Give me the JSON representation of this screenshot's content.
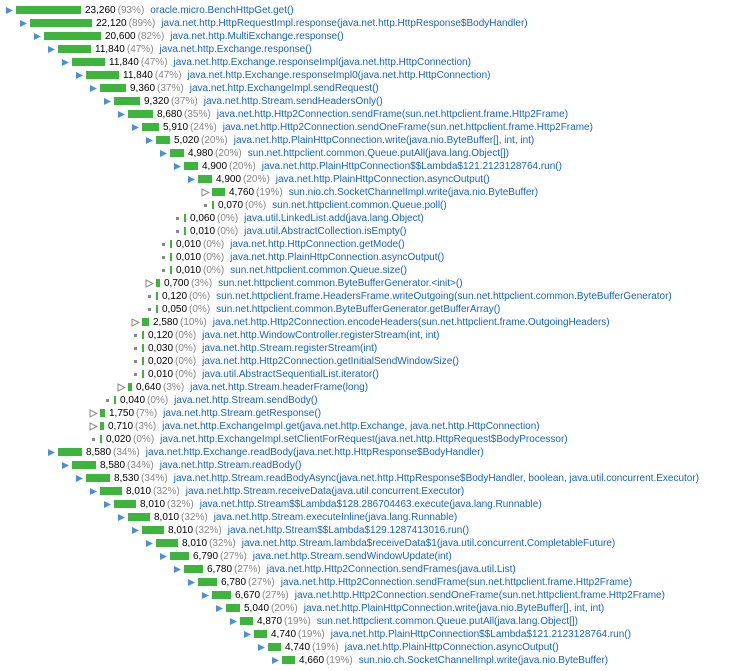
{
  "bar_max_width": 70,
  "rows": [
    {
      "d": 0,
      "t": "open",
      "time": "23,260",
      "pct": "93%",
      "w": 93,
      "m": "oracle.micro.BenchHttpGet.get()"
    },
    {
      "d": 1,
      "t": "open",
      "time": "22,120",
      "pct": "89%",
      "w": 89,
      "m": "java.net.http.HttpRequestImpl.response(java.net.http.HttpResponse$BodyHandler)"
    },
    {
      "d": 2,
      "t": "open",
      "time": "20,600",
      "pct": "82%",
      "w": 82,
      "m": "java.net.http.MultiExchange.response()"
    },
    {
      "d": 3,
      "t": "open",
      "time": "11,840",
      "pct": "47%",
      "w": 47,
      "m": "java.net.http.Exchange.response()"
    },
    {
      "d": 4,
      "t": "open",
      "time": "11,840",
      "pct": "47%",
      "w": 47,
      "m": "java.net.http.Exchange.responseImpl(java.net.http.HttpConnection)"
    },
    {
      "d": 5,
      "t": "open",
      "time": "11,840",
      "pct": "47%",
      "w": 47,
      "m": "java.net.http.Exchange.responseImpl0(java.net.http.HttpConnection)"
    },
    {
      "d": 6,
      "t": "open",
      "time": "9,360",
      "pct": "37%",
      "w": 37,
      "m": "java.net.http.ExchangeImpl.sendRequest()"
    },
    {
      "d": 7,
      "t": "open",
      "time": "9,320",
      "pct": "37%",
      "w": 37,
      "m": "java.net.http.Stream.sendHeadersOnly()"
    },
    {
      "d": 8,
      "t": "open",
      "time": "8,680",
      "pct": "35%",
      "w": 35,
      "m": "java.net.http.Http2Connection.sendFrame(sun.net.httpclient.frame.Http2Frame)"
    },
    {
      "d": 9,
      "t": "open",
      "time": "5,910",
      "pct": "24%",
      "w": 24,
      "m": "java.net.http.Http2Connection.sendOneFrame(sun.net.httpclient.frame.Http2Frame)"
    },
    {
      "d": 10,
      "t": "open",
      "time": "5,020",
      "pct": "20%",
      "w": 20,
      "m": "java.net.http.PlainHttpConnection.write(java.nio.ByteBuffer[], int, int)"
    },
    {
      "d": 11,
      "t": "open",
      "time": "4,980",
      "pct": "20%",
      "w": 20,
      "m": "sun.net.httpclient.common.Queue.putAll(java.lang.Object[])"
    },
    {
      "d": 12,
      "t": "open",
      "time": "4,900",
      "pct": "20%",
      "w": 20,
      "m": "java.net.http.PlainHttpConnection$$Lambda$121.2123128764.run()"
    },
    {
      "d": 13,
      "t": "open",
      "time": "4,900",
      "pct": "20%",
      "w": 20,
      "m": "java.net.http.PlainHttpConnection.asyncOutput()"
    },
    {
      "d": 14,
      "t": "closed",
      "time": "4,760",
      "pct": "19%",
      "w": 19,
      "m": "sun.nio.ch.SocketChannelImpl.write(java.nio.ByteBuffer)"
    },
    {
      "d": 14,
      "t": "leaf",
      "time": "0,070",
      "pct": "0%",
      "w": 2,
      "m": "sun.net.httpclient.common.Queue.poll()"
    },
    {
      "d": 12,
      "t": "leaf",
      "time": "0,060",
      "pct": "0%",
      "w": 2,
      "m": "java.util.LinkedList.add(java.lang.Object)"
    },
    {
      "d": 12,
      "t": "leaf",
      "time": "0,010",
      "pct": "0%",
      "w": 2,
      "m": "java.util.AbstractCollection.isEmpty()"
    },
    {
      "d": 11,
      "t": "leaf",
      "time": "0,010",
      "pct": "0%",
      "w": 2,
      "m": "java.net.http.HttpConnection.getMode()"
    },
    {
      "d": 11,
      "t": "leaf",
      "time": "0,010",
      "pct": "0%",
      "w": 2,
      "m": "java.net.http.PlainHttpConnection.asyncOutput()"
    },
    {
      "d": 11,
      "t": "leaf",
      "time": "0,010",
      "pct": "0%",
      "w": 2,
      "m": "sun.net.httpclient.common.Queue.size()"
    },
    {
      "d": 10,
      "t": "closed",
      "time": "0,700",
      "pct": "3%",
      "w": 5,
      "m": "sun.net.httpclient.common.ByteBufferGenerator.<init>()"
    },
    {
      "d": 10,
      "t": "leaf",
      "time": "0,120",
      "pct": "0%",
      "w": 2,
      "m": "sun.net.httpclient.frame.HeadersFrame.writeOutgoing(sun.net.httpclient.common.ByteBufferGenerator)"
    },
    {
      "d": 10,
      "t": "leaf",
      "time": "0,050",
      "pct": "0%",
      "w": 2,
      "m": "sun.net.httpclient.common.ByteBufferGenerator.getBufferArray()"
    },
    {
      "d": 9,
      "t": "closed",
      "time": "2,580",
      "pct": "10%",
      "w": 10,
      "m": "java.net.http.Http2Connection.encodeHeaders(sun.net.httpclient.frame.OutgoingHeaders)"
    },
    {
      "d": 9,
      "t": "leaf",
      "time": "0,120",
      "pct": "0%",
      "w": 2,
      "m": "java.net.http.WindowController.registerStream(int, int)"
    },
    {
      "d": 9,
      "t": "leaf",
      "time": "0,030",
      "pct": "0%",
      "w": 2,
      "m": "java.net.http.Stream.registerStream(int)"
    },
    {
      "d": 9,
      "t": "leaf",
      "time": "0,020",
      "pct": "0%",
      "w": 2,
      "m": "java.net.http.Http2Connection.getInitialSendWindowSize()"
    },
    {
      "d": 9,
      "t": "leaf",
      "time": "0,010",
      "pct": "0%",
      "w": 2,
      "m": "java.util.AbstractSequentialList.iterator()"
    },
    {
      "d": 8,
      "t": "closed",
      "time": "0,640",
      "pct": "3%",
      "w": 5,
      "m": "java.net.http.Stream.headerFrame(long)"
    },
    {
      "d": 7,
      "t": "leaf",
      "time": "0,040",
      "pct": "0%",
      "w": 2,
      "m": "java.net.http.Stream.sendBody()"
    },
    {
      "d": 6,
      "t": "closed",
      "time": "1,750",
      "pct": "7%",
      "w": 7,
      "m": "java.net.http.Stream.getResponse()"
    },
    {
      "d": 6,
      "t": "closed",
      "time": "0,710",
      "pct": "3%",
      "w": 5,
      "m": "java.net.http.ExchangeImpl.get(java.net.http.Exchange, java.net.http.HttpConnection)"
    },
    {
      "d": 6,
      "t": "leaf",
      "time": "0,020",
      "pct": "0%",
      "w": 2,
      "m": "java.net.http.ExchangeImpl.setClientForRequest(java.net.http.HttpRequest$BodyProcessor)"
    },
    {
      "d": 3,
      "t": "open",
      "time": "8,580",
      "pct": "34%",
      "w": 34,
      "m": "java.net.http.Exchange.readBody(java.net.http.HttpResponse$BodyHandler)"
    },
    {
      "d": 4,
      "t": "open",
      "time": "8,580",
      "pct": "34%",
      "w": 34,
      "m": "java.net.http.Stream.readBody()"
    },
    {
      "d": 5,
      "t": "open",
      "time": "8,530",
      "pct": "34%",
      "w": 34,
      "m": "java.net.http.Stream.readBodyAsync(java.net.http.HttpResponse$BodyHandler, boolean, java.util.concurrent.Executor)"
    },
    {
      "d": 6,
      "t": "open",
      "time": "8,010",
      "pct": "32%",
      "w": 32,
      "m": "java.net.http.Stream.receiveData(java.util.concurrent.Executor)"
    },
    {
      "d": 7,
      "t": "open",
      "time": "8,010",
      "pct": "32%",
      "w": 32,
      "m": "java.net.http.Stream$$Lambda$128.286704463.execute(java.lang.Runnable)"
    },
    {
      "d": 8,
      "t": "open",
      "time": "8,010",
      "pct": "32%",
      "w": 32,
      "m": "java.net.http.Stream.executeInline(java.lang.Runnable)"
    },
    {
      "d": 9,
      "t": "open",
      "time": "8,010",
      "pct": "32%",
      "w": 32,
      "m": "java.net.http.Stream$$Lambda$129.1287413016.run()"
    },
    {
      "d": 10,
      "t": "open",
      "time": "8,010",
      "pct": "32%",
      "w": 32,
      "m": "java.net.http.Stream.lambda$receiveData$1(java.util.concurrent.CompletableFuture)"
    },
    {
      "d": 11,
      "t": "open",
      "time": "6,790",
      "pct": "27%",
      "w": 27,
      "m": "java.net.http.Stream.sendWindowUpdate(int)"
    },
    {
      "d": 12,
      "t": "open",
      "time": "6,780",
      "pct": "27%",
      "w": 27,
      "m": "java.net.http.Http2Connection.sendFrames(java.util.List)"
    },
    {
      "d": 13,
      "t": "open",
      "time": "6,780",
      "pct": "27%",
      "w": 27,
      "m": "java.net.http.Http2Connection.sendFrame(sun.net.httpclient.frame.Http2Frame)"
    },
    {
      "d": 14,
      "t": "open",
      "time": "6,670",
      "pct": "27%",
      "w": 27,
      "m": "java.net.http.Http2Connection.sendOneFrame(sun.net.httpclient.frame.Http2Frame)"
    },
    {
      "d": 15,
      "t": "open",
      "time": "5,040",
      "pct": "20%",
      "w": 20,
      "m": "java.net.http.PlainHttpConnection.write(java.nio.ByteBuffer[], int, int)"
    },
    {
      "d": 16,
      "t": "open",
      "time": "4,870",
      "pct": "19%",
      "w": 19,
      "m": "sun.net.httpclient.common.Queue.putAll(java.lang.Object[])"
    },
    {
      "d": 17,
      "t": "open",
      "time": "4,740",
      "pct": "19%",
      "w": 19,
      "m": "java.net.http.PlainHttpConnection$$Lambda$121.2123128764.run()"
    },
    {
      "d": 18,
      "t": "open",
      "time": "4,740",
      "pct": "19%",
      "w": 19,
      "m": "java.net.http.PlainHttpConnection.asyncOutput()"
    },
    {
      "d": 19,
      "t": "open",
      "time": "4,660",
      "pct": "19%",
      "w": 19,
      "m": "sun.nio.ch.SocketChannelImpl.write(java.nio.ByteBuffer)"
    }
  ]
}
